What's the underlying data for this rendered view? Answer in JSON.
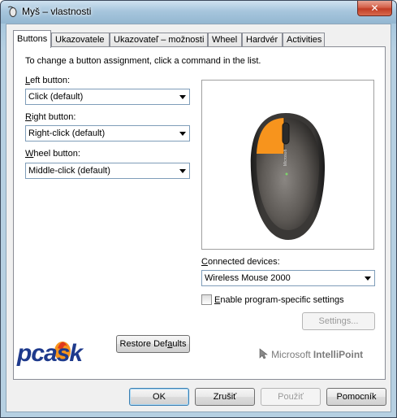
{
  "window": {
    "title": "Myš – vlastnosti",
    "close_label": "✕"
  },
  "tabs": [
    {
      "label": "Buttons"
    },
    {
      "label": "Ukazovatele"
    },
    {
      "label": "Ukazovateľ – možnosti"
    },
    {
      "label": "Wheel"
    },
    {
      "label": "Hardvér"
    },
    {
      "label": "Activities"
    }
  ],
  "panel": {
    "instruction": "To change a button assignment, click a command in the list.",
    "left_button": {
      "label_first": "L",
      "label_rest": "eft button:",
      "value": "Click (default)"
    },
    "right_button": {
      "label_first": "R",
      "label_rest": "ight button:",
      "value": "Right-click (default)"
    },
    "wheel_button": {
      "label_first": "W",
      "label_rest": "heel button:",
      "value": "Middle-click (default)"
    },
    "connected_devices": {
      "label_first": "C",
      "label_rest": "onnected devices:",
      "value": "Wireless Mouse 2000"
    },
    "program_specific": {
      "label_first": "E",
      "label_rest": "nable program-specific settings",
      "checked": false
    },
    "settings_button": "Settings...",
    "restore_button": {
      "pre": "Restore Def",
      "underlined": "a",
      "post": "ults"
    },
    "brand_logo_text": "pcask",
    "brand_microsoft": "Microsoft",
    "brand_intellipoint": "IntelliPoint",
    "highlight_color": "#f7941d"
  },
  "footer": {
    "ok": "OK",
    "cancel": "Zrušiť",
    "apply": "Použiť",
    "help": "Pomocník"
  }
}
